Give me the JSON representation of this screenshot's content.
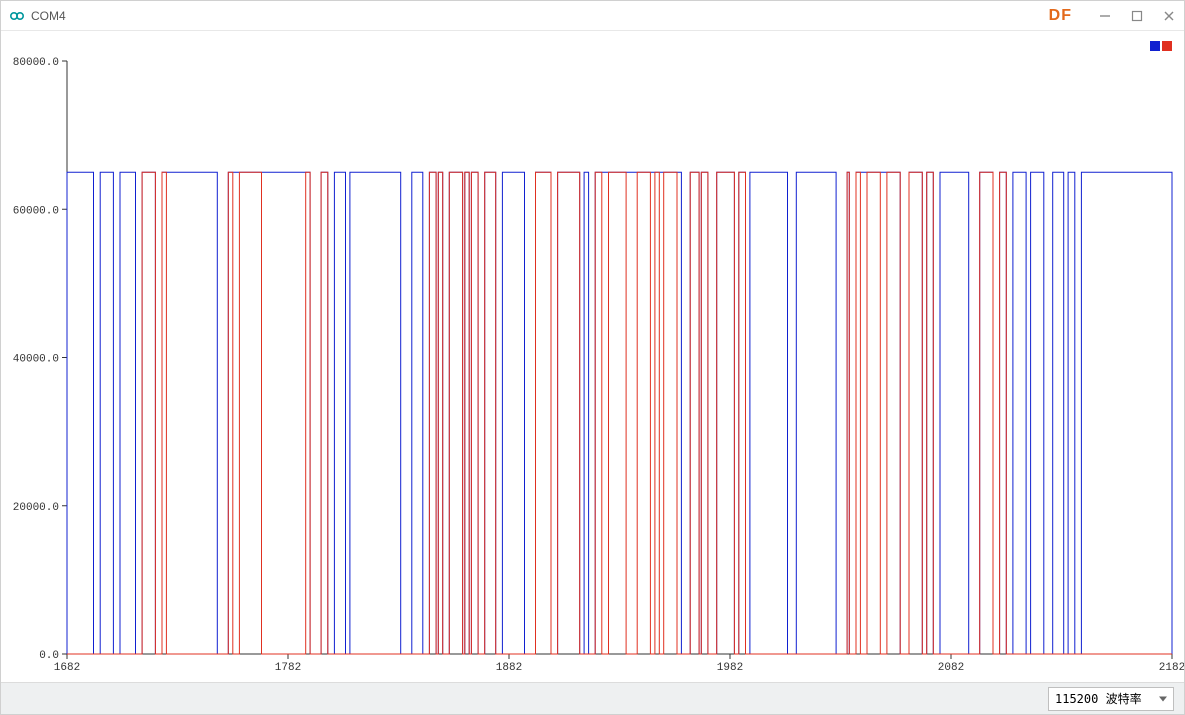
{
  "window": {
    "title": "COM4",
    "brand": "DF"
  },
  "legend": {
    "series1_color": "#1020d0",
    "series2_color": "#e03020"
  },
  "statusbar": {
    "baud_display": "115200 波特率"
  },
  "chart_data": {
    "type": "line",
    "xlabel": "",
    "ylabel": "",
    "xlim": [
      1682,
      2182
    ],
    "ylim": [
      0,
      80000
    ],
    "y_ticks": [
      0.0,
      20000.0,
      40000.0,
      60000.0,
      80000.0
    ],
    "y_tick_labels": [
      "0.0",
      "20000.0",
      "40000.0",
      "60000.0",
      "80000.0"
    ],
    "x_ticks": [
      1682,
      1782,
      1882,
      1982,
      2082,
      2182
    ],
    "x_tick_labels": [
      "1682",
      "1782",
      "1882",
      "1982",
      "2082",
      "2182"
    ],
    "high_value": 65000,
    "low_value": 0,
    "series": [
      {
        "name": "series1",
        "color": "#1020d0",
        "segments_high": [
          [
            1682,
            1694
          ],
          [
            1697,
            1703
          ],
          [
            1706,
            1713
          ],
          [
            1716,
            1722
          ],
          [
            1725,
            1750
          ],
          [
            1755,
            1792
          ],
          [
            1797,
            1800
          ],
          [
            1803,
            1808
          ],
          [
            1810,
            1833
          ],
          [
            1838,
            1843
          ],
          [
            1846,
            1849
          ],
          [
            1850,
            1852
          ],
          [
            1855,
            1861
          ],
          [
            1862,
            1864
          ],
          [
            1865,
            1868
          ],
          [
            1871,
            1876
          ],
          [
            1879,
            1889
          ],
          [
            1894,
            1901
          ],
          [
            1904,
            1914
          ],
          [
            1916,
            1918
          ],
          [
            1921,
            1960
          ],
          [
            1964,
            1968
          ],
          [
            1969,
            1972
          ],
          [
            1976,
            1984
          ],
          [
            1986,
            1989
          ],
          [
            1991,
            2008
          ],
          [
            2012,
            2030
          ],
          [
            2035,
            2036
          ],
          [
            2039,
            2059
          ],
          [
            2063,
            2069
          ],
          [
            2071,
            2074
          ],
          [
            2077,
            2090
          ],
          [
            2095,
            2101
          ],
          [
            2104,
            2107
          ],
          [
            2110,
            2116
          ],
          [
            2118,
            2124
          ],
          [
            2128,
            2133
          ],
          [
            2135,
            2138
          ],
          [
            2141,
            2182
          ]
        ]
      },
      {
        "name": "series2",
        "color": "#e03020",
        "segments_high": [
          [
            1716,
            1722
          ],
          [
            1725,
            1727
          ],
          [
            1755,
            1757
          ],
          [
            1760,
            1770
          ],
          [
            1790,
            1792
          ],
          [
            1797,
            1800
          ],
          [
            1846,
            1849
          ],
          [
            1850,
            1852
          ],
          [
            1855,
            1861
          ],
          [
            1862,
            1864
          ],
          [
            1865,
            1868
          ],
          [
            1871,
            1876
          ],
          [
            1894,
            1901
          ],
          [
            1904,
            1914
          ],
          [
            1921,
            1924
          ],
          [
            1927,
            1935
          ],
          [
            1940,
            1946
          ],
          [
            1948,
            1950
          ],
          [
            1952,
            1958
          ],
          [
            1964,
            1968
          ],
          [
            1969,
            1972
          ],
          [
            1976,
            1984
          ],
          [
            1986,
            1989
          ],
          [
            2035,
            2036
          ],
          [
            2039,
            2041
          ],
          [
            2044,
            2050
          ],
          [
            2053,
            2059
          ],
          [
            2063,
            2069
          ],
          [
            2071,
            2074
          ],
          [
            2095,
            2101
          ],
          [
            2104,
            2107
          ]
        ]
      }
    ]
  }
}
